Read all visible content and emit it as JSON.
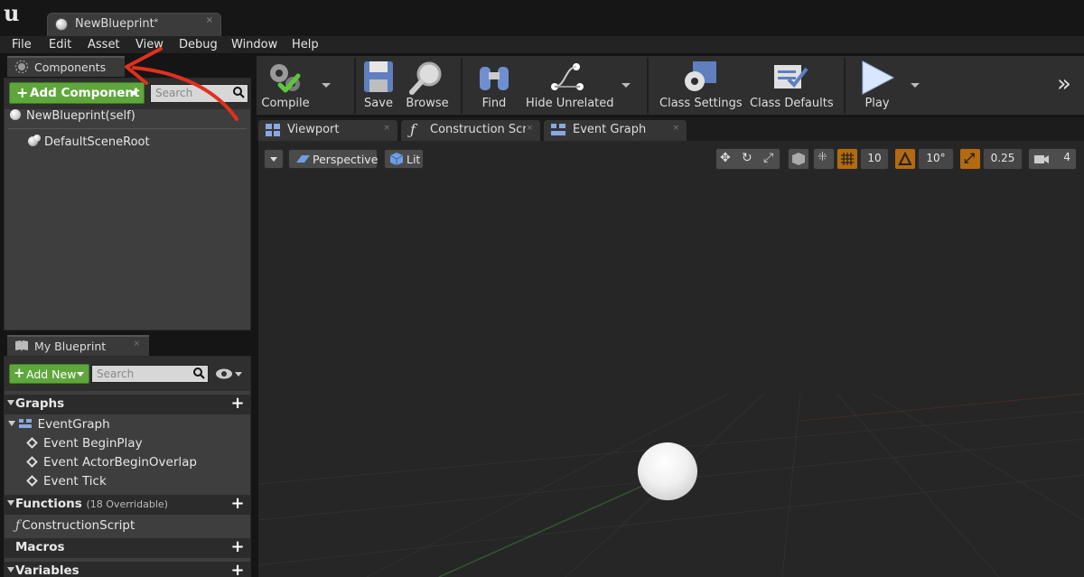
{
  "window": {
    "doc_tab_title": "NewBlueprint",
    "doc_tab_modified": "*",
    "close_glyph": "×"
  },
  "menu": [
    "File",
    "Edit",
    "Asset",
    "View",
    "Debug",
    "Window",
    "Help"
  ],
  "components_panel": {
    "tab_label": "Components",
    "add_button_label": "Add Component",
    "add_button_prefix": "+",
    "search_placeholder": "Search",
    "tree": [
      {
        "label": "NewBlueprint(self)",
        "icon": "sphere-icon"
      },
      {
        "label": "DefaultSceneRoot",
        "icon": "scene-root-icon"
      }
    ]
  },
  "toolbar": {
    "buttons": [
      {
        "label": "Compile",
        "icon": "compile-gears-icon",
        "has_dropdown": true
      },
      {
        "label": "Save",
        "icon": "floppy-disk-icon"
      },
      {
        "label": "Browse",
        "icon": "magnifier-icon"
      },
      {
        "label": "Find",
        "icon": "binoculars-icon"
      },
      {
        "label": "Hide Unrelated",
        "icon": "node-graph-icon",
        "has_dropdown": true
      },
      {
        "label": "Class Settings",
        "icon": "gear-settings-icon"
      },
      {
        "label": "Class Defaults",
        "icon": "checklist-icon"
      },
      {
        "label": "Play",
        "icon": "play-icon",
        "has_dropdown": true
      }
    ],
    "overflow_glyph": "»"
  },
  "editor_tabs": [
    {
      "label": "Viewport",
      "icon": "viewport-grid-icon"
    },
    {
      "label": "Construction Scrip",
      "icon": "function-icon"
    },
    {
      "label": "Event Graph",
      "icon": "event-graph-icon"
    }
  ],
  "viewport": {
    "perspective_label": "Perspective",
    "lit_label": "Lit",
    "grid_snap_value": "10",
    "rotation_snap_value": "10°",
    "scale_snap_value": "0.25",
    "camera_speed_value": "4",
    "accent_orange": "#b56a10"
  },
  "my_blueprint": {
    "tab_label": "My Blueprint",
    "add_new_label": "Add New",
    "add_new_prefix": "+",
    "search_placeholder": "Search",
    "graphs_label": "Graphs",
    "event_graph_label": "EventGraph",
    "events": [
      "Event BeginPlay",
      "Event ActorBeginOverlap",
      "Event Tick"
    ],
    "functions_label": "Functions",
    "functions_note": "(18 Overridable)",
    "construction_script_label": "ConstructionScript",
    "macros_label": "Macros",
    "variables_label": "Variables"
  },
  "colors": {
    "green_button": "#5fa63d",
    "annotation_red": "#e0301e"
  }
}
